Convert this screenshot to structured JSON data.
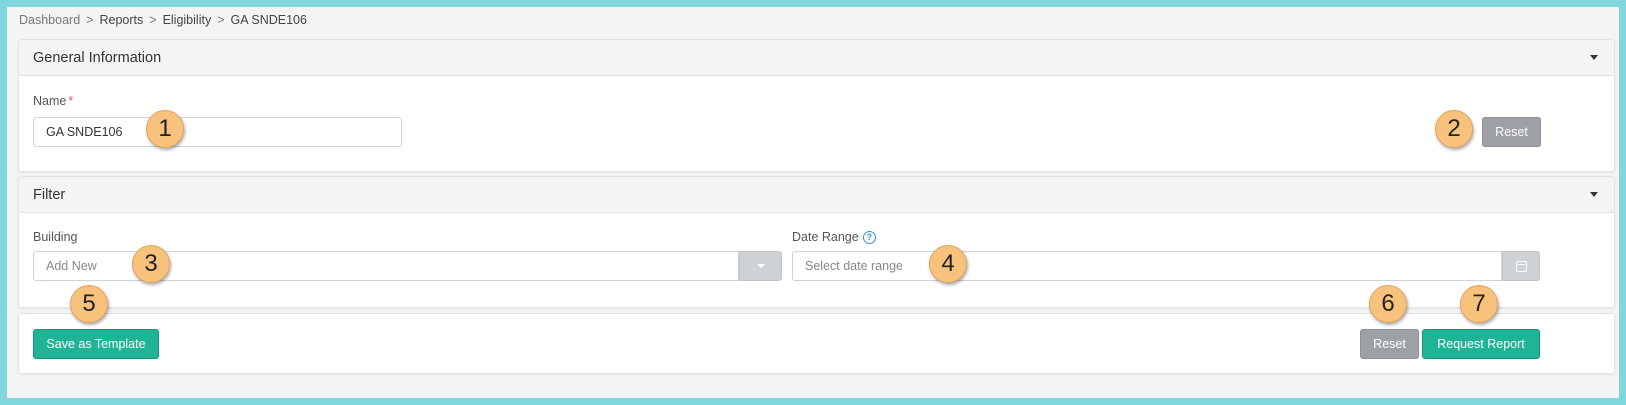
{
  "breadcrumb": {
    "items": [
      "Dashboard",
      "Reports",
      "Eligibility",
      "GA SNDE106"
    ],
    "separator": ">"
  },
  "general": {
    "title": "General Information",
    "name_label": "Name",
    "required_mark": "*",
    "name_value": "GA SNDE106",
    "reset_label": "Reset"
  },
  "filter": {
    "title": "Filter",
    "building_label": "Building",
    "building_placeholder": "Add New",
    "date_label": "Date Range",
    "date_help": "?",
    "date_placeholder": "Select date range"
  },
  "footer": {
    "save_template_label": "Save as Template",
    "reset_label": "Reset",
    "request_label": "Request Report"
  },
  "callouts": [
    "1",
    "2",
    "3",
    "4",
    "5",
    "6",
    "7"
  ],
  "colors": {
    "frame": "#7fd6dc",
    "primary": "#1fb496",
    "secondary": "#9da0a4",
    "callout": "#f8c27d"
  }
}
